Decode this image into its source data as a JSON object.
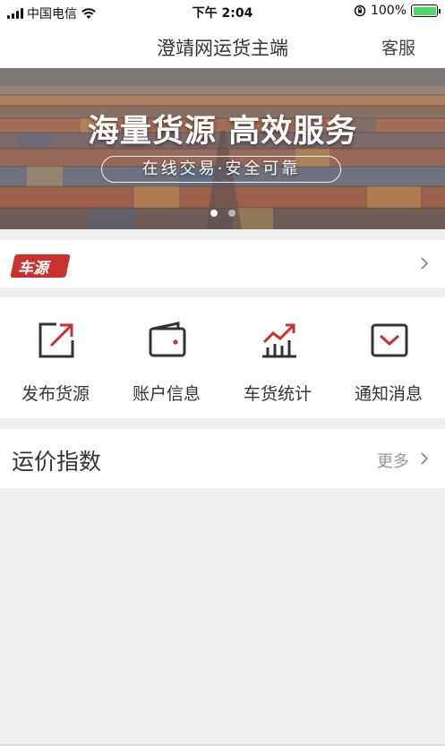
{
  "status_bar": {
    "carrier": "中国电信",
    "time": "下午 2:04",
    "battery_percent": "100%",
    "battery_level": 1.0
  },
  "nav": {
    "title": "澄靖网运货主端",
    "right_action": "客服"
  },
  "banner": {
    "headline": "海量货源 高效服务",
    "tagline": "在线交易·安全可靠",
    "page_count": 2,
    "active_page": 1
  },
  "cheyuan": {
    "badge": "车源"
  },
  "quick_actions": [
    {
      "label": "发布货源",
      "icon": "publish-icon"
    },
    {
      "label": "账户信息",
      "icon": "wallet-icon"
    },
    {
      "label": "车货统计",
      "icon": "chart-icon"
    },
    {
      "label": "通知消息",
      "icon": "message-icon"
    }
  ],
  "freight_index": {
    "title": "运价指数",
    "more": "更多"
  },
  "colors": {
    "accent_red": "#c8312d",
    "icon_dark": "#333333"
  }
}
